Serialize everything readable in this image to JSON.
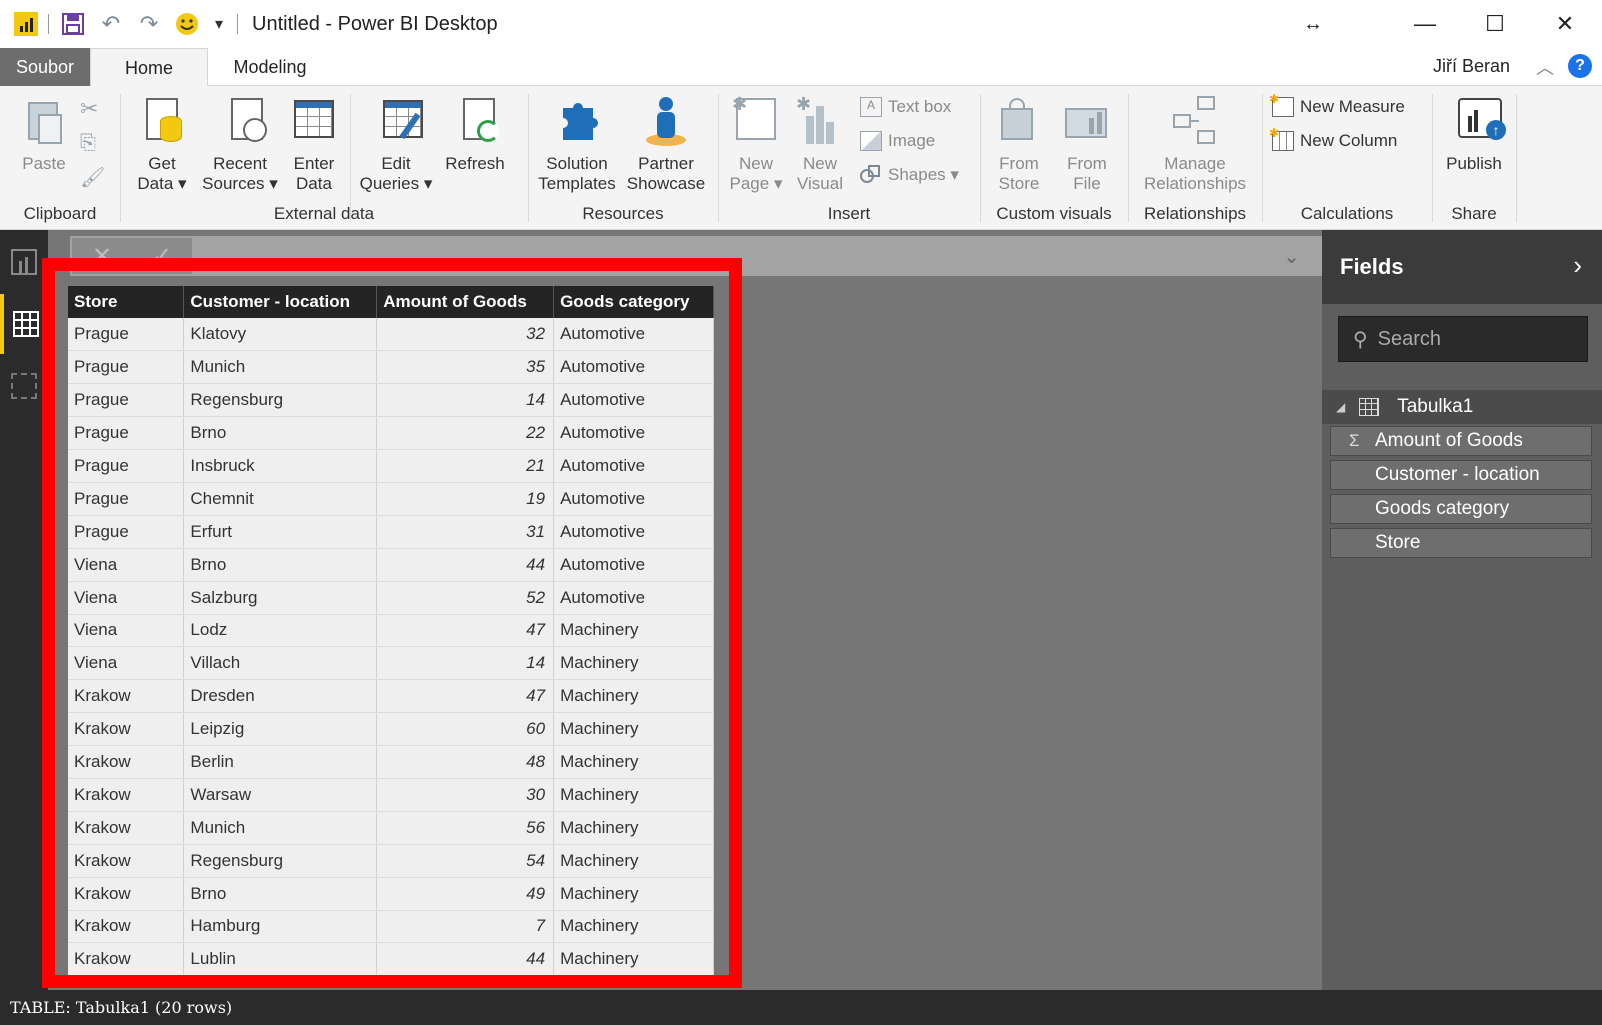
{
  "window": {
    "title": "Untitled - Power BI Desktop"
  },
  "ribbon_tabs": {
    "file": "Soubor",
    "home": "Home",
    "modeling": "Modeling"
  },
  "user": {
    "name": "Jiří Beran"
  },
  "groups": {
    "clipboard": {
      "label": "Clipboard",
      "paste": "Paste"
    },
    "external_data": {
      "label": "External data",
      "get_data": [
        "Get",
        "Data"
      ],
      "recent_sources": [
        "Recent",
        "Sources"
      ],
      "enter_data": [
        "Enter",
        "Data"
      ],
      "edit_queries": [
        "Edit",
        "Queries"
      ],
      "refresh": "Refresh"
    },
    "resources": {
      "label": "Resources",
      "solution_templates": [
        "Solution",
        "Templates"
      ],
      "partner_showcase": [
        "Partner",
        "Showcase"
      ]
    },
    "insert": {
      "label": "Insert",
      "new_page": [
        "New",
        "Page"
      ],
      "new_visual": [
        "New",
        "Visual"
      ],
      "text_box": "Text box",
      "image": "Image",
      "shapes": "Shapes"
    },
    "custom_visuals": {
      "label": "Custom visuals",
      "from_store": [
        "From",
        "Store"
      ],
      "from_file": [
        "From",
        "File"
      ]
    },
    "relationships": {
      "label": "Relationships",
      "manage": [
        "Manage",
        "Relationships"
      ]
    },
    "calculations": {
      "label": "Calculations",
      "new_measure": "New Measure",
      "new_column": "New Column"
    },
    "share": {
      "label": "Share",
      "publish": "Publish"
    }
  },
  "table": {
    "headers": [
      "Store",
      "Customer - location",
      "Amount of Goods",
      "Goods category"
    ],
    "rows": [
      [
        "Prague",
        "Klatovy",
        "32",
        "Automotive"
      ],
      [
        "Prague",
        "Munich",
        "35",
        "Automotive"
      ],
      [
        "Prague",
        "Regensburg",
        "14",
        "Automotive"
      ],
      [
        "Prague",
        "Brno",
        "22",
        "Automotive"
      ],
      [
        "Prague",
        "Insbruck",
        "21",
        "Automotive"
      ],
      [
        "Prague",
        "Chemnit",
        "19",
        "Automotive"
      ],
      [
        "Prague",
        "Erfurt",
        "31",
        "Automotive"
      ],
      [
        "Viena",
        "Brno",
        "44",
        "Automotive"
      ],
      [
        "Viena",
        "Salzburg",
        "52",
        "Automotive"
      ],
      [
        "Viena",
        "Lodz",
        "47",
        "Machinery"
      ],
      [
        "Viena",
        "Villach",
        "14",
        "Machinery"
      ],
      [
        "Krakow",
        "Dresden",
        "47",
        "Machinery"
      ],
      [
        "Krakow",
        "Leipzig",
        "60",
        "Machinery"
      ],
      [
        "Krakow",
        "Berlin",
        "48",
        "Machinery"
      ],
      [
        "Krakow",
        "Warsaw",
        "30",
        "Machinery"
      ],
      [
        "Krakow",
        "Munich",
        "56",
        "Machinery"
      ],
      [
        "Krakow",
        "Regensburg",
        "54",
        "Machinery"
      ],
      [
        "Krakow",
        "Brno",
        "49",
        "Machinery"
      ],
      [
        "Krakow",
        "Hamburg",
        "7",
        "Machinery"
      ],
      [
        "Krakow",
        "Lublin",
        "44",
        "Machinery"
      ]
    ]
  },
  "fields_pane": {
    "title": "Fields",
    "search_placeholder": "Search",
    "table_name": "Tabulka1",
    "fields": [
      "Amount of Goods",
      "Customer - location",
      "Goods category",
      "Store"
    ]
  },
  "status": {
    "text": "TABLE: Tabulka1 (20 rows)"
  },
  "colors": {
    "accent": "#f2c811",
    "highlight": "#ff0000",
    "file_tab": "#6d6d6d",
    "canvas": "#767676"
  }
}
